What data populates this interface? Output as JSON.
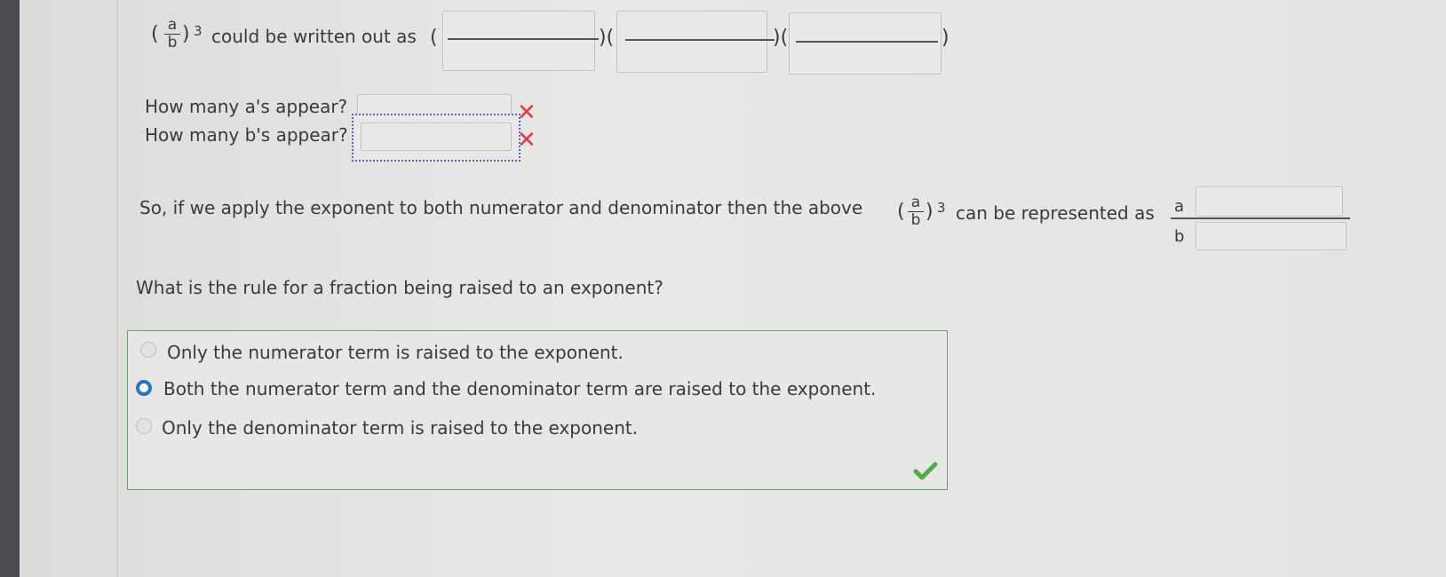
{
  "expression": {
    "numerator": "a",
    "denominator": "b",
    "exponent": "3",
    "open_paren": "(",
    "close_paren": ")"
  },
  "q1": {
    "text": "could be written out as",
    "separators": [
      "(",
      ")(",
      ")(",
      ")"
    ],
    "boxes": [
      "",
      "",
      ""
    ]
  },
  "q2": {
    "a_label": "How many a's appear?",
    "b_label": "How many b's appear?",
    "a_value": "",
    "b_value": "",
    "a_status": "incorrect",
    "b_status": "incorrect",
    "wrong_glyph": "✕"
  },
  "q3": {
    "text_before": "So, if we apply the exponent to both numerator and denominator then the above",
    "text_after": "can be represented as",
    "numerator_base": "a",
    "denominator_base": "b",
    "numerator_exponent": "",
    "denominator_exponent": ""
  },
  "q4": {
    "prompt": "What is the rule for a fraction being raised to an exponent?",
    "options": [
      "Only the numerator term is raised to the exponent.",
      "Both the numerator term and the denominator term are raised to the exponent.",
      "Only the denominator term is raised to the exponent."
    ],
    "selected_index": 1,
    "status": "correct"
  },
  "colors": {
    "accent": "#2b72c9",
    "wrong": "#e4384b",
    "correct": "#57a84a",
    "box_border": "#6fa16d",
    "focus": "#5b66b8"
  }
}
